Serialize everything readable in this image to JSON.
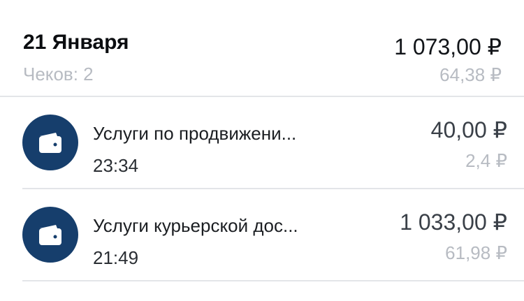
{
  "day": {
    "date": "21 Января",
    "receipts": "Чеков: 2",
    "total": "1 073,00 ₽",
    "bonus": "64,38 ₽"
  },
  "transactions": [
    {
      "icon": "wallet-icon",
      "title": "Услуги по продвижени...",
      "time": "23:34",
      "amount": "40,00 ₽",
      "bonus": "2,4 ₽"
    },
    {
      "icon": "wallet-icon",
      "title": "Услуги курьерской дос...",
      "time": "21:49",
      "amount": "1 033,00 ₽",
      "bonus": "61,98 ₽"
    }
  ],
  "colors": {
    "avatar_bg": "#163e6c",
    "muted_text": "#b7bbc2",
    "divider": "#e3e5e8"
  }
}
